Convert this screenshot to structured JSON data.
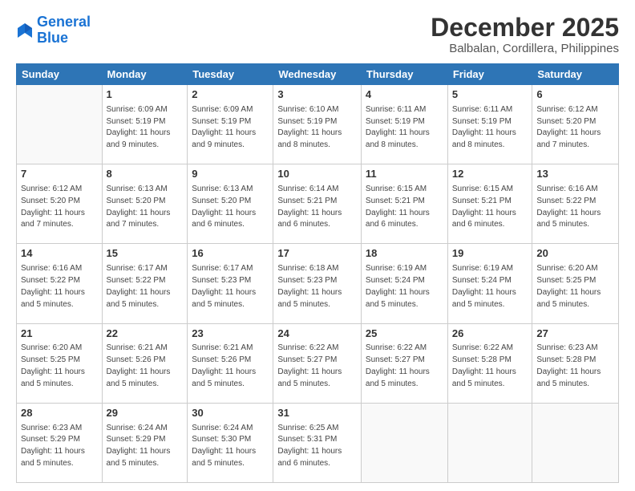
{
  "header": {
    "logo_line1": "General",
    "logo_line2": "Blue",
    "month": "December 2025",
    "location": "Balbalan, Cordillera, Philippines"
  },
  "days_of_week": [
    "Sunday",
    "Monday",
    "Tuesday",
    "Wednesday",
    "Thursday",
    "Friday",
    "Saturday"
  ],
  "weeks": [
    [
      {
        "day": "",
        "sunrise": "",
        "sunset": "",
        "daylight": ""
      },
      {
        "day": "1",
        "sunrise": "Sunrise: 6:09 AM",
        "sunset": "Sunset: 5:19 PM",
        "daylight": "Daylight: 11 hours and 9 minutes."
      },
      {
        "day": "2",
        "sunrise": "Sunrise: 6:09 AM",
        "sunset": "Sunset: 5:19 PM",
        "daylight": "Daylight: 11 hours and 9 minutes."
      },
      {
        "day": "3",
        "sunrise": "Sunrise: 6:10 AM",
        "sunset": "Sunset: 5:19 PM",
        "daylight": "Daylight: 11 hours and 8 minutes."
      },
      {
        "day": "4",
        "sunrise": "Sunrise: 6:11 AM",
        "sunset": "Sunset: 5:19 PM",
        "daylight": "Daylight: 11 hours and 8 minutes."
      },
      {
        "day": "5",
        "sunrise": "Sunrise: 6:11 AM",
        "sunset": "Sunset: 5:19 PM",
        "daylight": "Daylight: 11 hours and 8 minutes."
      },
      {
        "day": "6",
        "sunrise": "Sunrise: 6:12 AM",
        "sunset": "Sunset: 5:20 PM",
        "daylight": "Daylight: 11 hours and 7 minutes."
      }
    ],
    [
      {
        "day": "7",
        "sunrise": "Sunrise: 6:12 AM",
        "sunset": "Sunset: 5:20 PM",
        "daylight": "Daylight: 11 hours and 7 minutes."
      },
      {
        "day": "8",
        "sunrise": "Sunrise: 6:13 AM",
        "sunset": "Sunset: 5:20 PM",
        "daylight": "Daylight: 11 hours and 7 minutes."
      },
      {
        "day": "9",
        "sunrise": "Sunrise: 6:13 AM",
        "sunset": "Sunset: 5:20 PM",
        "daylight": "Daylight: 11 hours and 6 minutes."
      },
      {
        "day": "10",
        "sunrise": "Sunrise: 6:14 AM",
        "sunset": "Sunset: 5:21 PM",
        "daylight": "Daylight: 11 hours and 6 minutes."
      },
      {
        "day": "11",
        "sunrise": "Sunrise: 6:15 AM",
        "sunset": "Sunset: 5:21 PM",
        "daylight": "Daylight: 11 hours and 6 minutes."
      },
      {
        "day": "12",
        "sunrise": "Sunrise: 6:15 AM",
        "sunset": "Sunset: 5:21 PM",
        "daylight": "Daylight: 11 hours and 6 minutes."
      },
      {
        "day": "13",
        "sunrise": "Sunrise: 6:16 AM",
        "sunset": "Sunset: 5:22 PM",
        "daylight": "Daylight: 11 hours and 5 minutes."
      }
    ],
    [
      {
        "day": "14",
        "sunrise": "Sunrise: 6:16 AM",
        "sunset": "Sunset: 5:22 PM",
        "daylight": "Daylight: 11 hours and 5 minutes."
      },
      {
        "day": "15",
        "sunrise": "Sunrise: 6:17 AM",
        "sunset": "Sunset: 5:22 PM",
        "daylight": "Daylight: 11 hours and 5 minutes."
      },
      {
        "day": "16",
        "sunrise": "Sunrise: 6:17 AM",
        "sunset": "Sunset: 5:23 PM",
        "daylight": "Daylight: 11 hours and 5 minutes."
      },
      {
        "day": "17",
        "sunrise": "Sunrise: 6:18 AM",
        "sunset": "Sunset: 5:23 PM",
        "daylight": "Daylight: 11 hours and 5 minutes."
      },
      {
        "day": "18",
        "sunrise": "Sunrise: 6:19 AM",
        "sunset": "Sunset: 5:24 PM",
        "daylight": "Daylight: 11 hours and 5 minutes."
      },
      {
        "day": "19",
        "sunrise": "Sunrise: 6:19 AM",
        "sunset": "Sunset: 5:24 PM",
        "daylight": "Daylight: 11 hours and 5 minutes."
      },
      {
        "day": "20",
        "sunrise": "Sunrise: 6:20 AM",
        "sunset": "Sunset: 5:25 PM",
        "daylight": "Daylight: 11 hours and 5 minutes."
      }
    ],
    [
      {
        "day": "21",
        "sunrise": "Sunrise: 6:20 AM",
        "sunset": "Sunset: 5:25 PM",
        "daylight": "Daylight: 11 hours and 5 minutes."
      },
      {
        "day": "22",
        "sunrise": "Sunrise: 6:21 AM",
        "sunset": "Sunset: 5:26 PM",
        "daylight": "Daylight: 11 hours and 5 minutes."
      },
      {
        "day": "23",
        "sunrise": "Sunrise: 6:21 AM",
        "sunset": "Sunset: 5:26 PM",
        "daylight": "Daylight: 11 hours and 5 minutes."
      },
      {
        "day": "24",
        "sunrise": "Sunrise: 6:22 AM",
        "sunset": "Sunset: 5:27 PM",
        "daylight": "Daylight: 11 hours and 5 minutes."
      },
      {
        "day": "25",
        "sunrise": "Sunrise: 6:22 AM",
        "sunset": "Sunset: 5:27 PM",
        "daylight": "Daylight: 11 hours and 5 minutes."
      },
      {
        "day": "26",
        "sunrise": "Sunrise: 6:22 AM",
        "sunset": "Sunset: 5:28 PM",
        "daylight": "Daylight: 11 hours and 5 minutes."
      },
      {
        "day": "27",
        "sunrise": "Sunrise: 6:23 AM",
        "sunset": "Sunset: 5:28 PM",
        "daylight": "Daylight: 11 hours and 5 minutes."
      }
    ],
    [
      {
        "day": "28",
        "sunrise": "Sunrise: 6:23 AM",
        "sunset": "Sunset: 5:29 PM",
        "daylight": "Daylight: 11 hours and 5 minutes."
      },
      {
        "day": "29",
        "sunrise": "Sunrise: 6:24 AM",
        "sunset": "Sunset: 5:29 PM",
        "daylight": "Daylight: 11 hours and 5 minutes."
      },
      {
        "day": "30",
        "sunrise": "Sunrise: 6:24 AM",
        "sunset": "Sunset: 5:30 PM",
        "daylight": "Daylight: 11 hours and 5 minutes."
      },
      {
        "day": "31",
        "sunrise": "Sunrise: 6:25 AM",
        "sunset": "Sunset: 5:31 PM",
        "daylight": "Daylight: 11 hours and 6 minutes."
      },
      {
        "day": "",
        "sunrise": "",
        "sunset": "",
        "daylight": ""
      },
      {
        "day": "",
        "sunrise": "",
        "sunset": "",
        "daylight": ""
      },
      {
        "day": "",
        "sunrise": "",
        "sunset": "",
        "daylight": ""
      }
    ]
  ]
}
